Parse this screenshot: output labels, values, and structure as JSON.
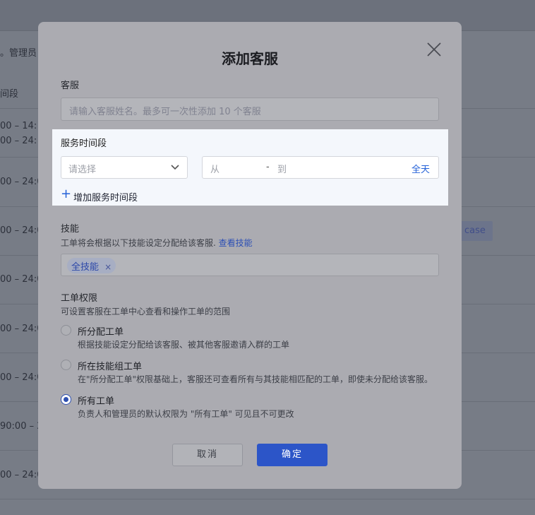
{
  "background": {
    "top_text": "。管理员",
    "col_header": "间段",
    "rows": [
      {
        "line1": "00 – 14:",
        "line2": "00 – 24:"
      },
      {
        "line1": "00 – 24:0",
        "line2": ""
      },
      {
        "line1": "00 – 24:0",
        "line2": ""
      },
      {
        "line1": "00 – 24:0",
        "line2": ""
      },
      {
        "line1": "00 – 24:0",
        "line2": ""
      },
      {
        "line1": "00 – 24:0",
        "line2": ""
      },
      {
        "line1": "90:00 – 2",
        "line2": ""
      },
      {
        "line1": "00 – 24:0",
        "line2": ""
      }
    ],
    "tag": "case"
  },
  "modal": {
    "title": "添加客服",
    "agent": {
      "label": "客服",
      "placeholder": "请输入客服姓名。最多可一次性添加 10 个客服"
    },
    "service_time": {
      "label": "服务时间段",
      "select_placeholder": "请选择",
      "from": "从",
      "dash": "-",
      "to": "到",
      "all_day": "全天",
      "add_label": "增加服务时间段",
      "plus": "+"
    },
    "skills": {
      "label": "技能",
      "desc": "工单将会根据以下技能设定分配给该客服.",
      "link": "查看技能",
      "tag": "全技能",
      "tag_remove": "×"
    },
    "permissions": {
      "label": "工单权限",
      "desc": "可设置客服在工单中心查看和操作工单的范围",
      "options": [
        {
          "title": "所分配工单",
          "desc": "根据技能设定分配给该客服、被其他客服邀请入群的工单",
          "checked": false
        },
        {
          "title": "所在技能组工单",
          "desc": "在\"所分配工单\"权限基础上，客服还可查看所有与其技能相匹配的工单，即使未分配给该客服。",
          "checked": false
        },
        {
          "title": "所有工单",
          "desc": "负责人和管理员的默认权限为 \"所有工单\" 可见且不可更改",
          "checked": true
        }
      ]
    },
    "buttons": {
      "cancel": "取消",
      "confirm": "确定"
    }
  },
  "colors": {
    "accent": "#2c55c8",
    "link": "#2461d8"
  },
  "icons": {
    "close": "close-icon",
    "chevron": "chevron-down-icon"
  }
}
